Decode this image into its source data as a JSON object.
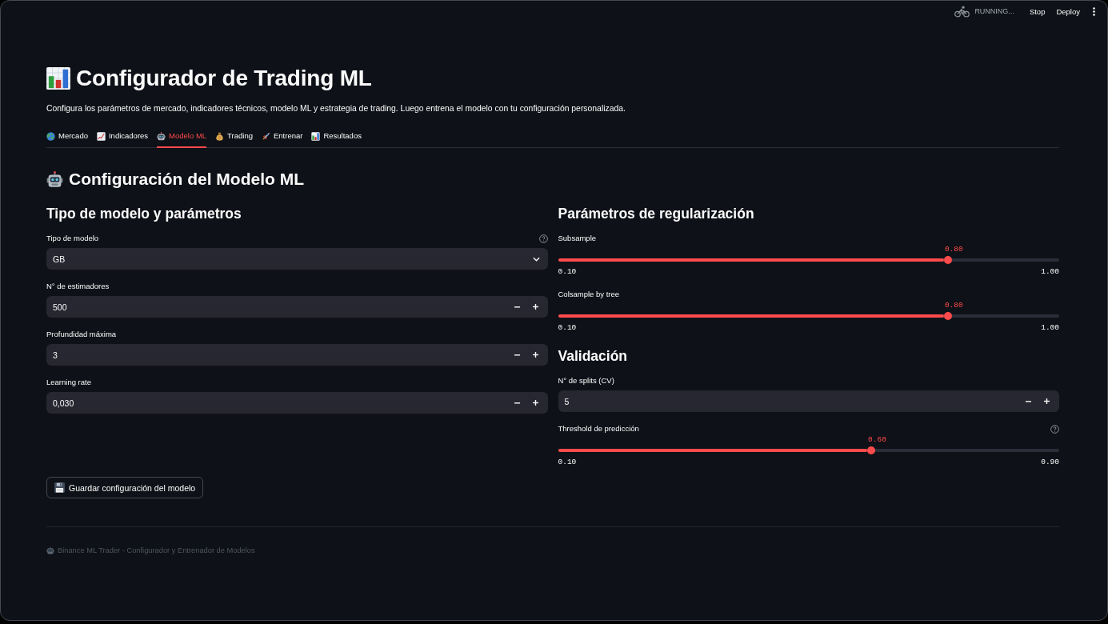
{
  "header": {
    "status": "RUNNING...",
    "buttons": [
      "Stop",
      "Deploy"
    ]
  },
  "page": {
    "title": "Configurador de Trading ML",
    "description": "Configura los parámetros de mercado, indicadores técnicos, modelo ML y estrategia de trading. Luego entrena el modelo con tu configuración personalizada."
  },
  "tabs": [
    {
      "label": "Mercado",
      "selected": false
    },
    {
      "label": "Indicadores",
      "selected": false
    },
    {
      "label": "Modelo ML",
      "selected": true
    },
    {
      "label": "Trading",
      "selected": false
    },
    {
      "label": "Entrenar",
      "selected": false
    },
    {
      "label": "Resultados",
      "selected": false
    }
  ],
  "section_title": "Configuración del Modelo ML",
  "columns": [
    {
      "sections": [
        {
          "heading": "Tipo de modelo y parámetros",
          "fields": [
            {
              "kind": "select",
              "label": "Tipo de modelo",
              "value": "GB",
              "help": true
            },
            {
              "kind": "number",
              "label": "N° de estimadores",
              "value": "500",
              "help": false
            },
            {
              "kind": "number",
              "label": "Profundidad máxima",
              "value": "3",
              "help": false
            },
            {
              "kind": "number",
              "label": "Learning rate",
              "value": "0,030",
              "help": false
            }
          ]
        }
      ]
    },
    {
      "sections": [
        {
          "heading": "Parámetros de regularización",
          "fields": [
            {
              "kind": "slider",
              "label": "Subsample",
              "value": "0.80",
              "level": 0.778,
              "min": "0.10",
              "max": "1.00",
              "help": false
            },
            {
              "kind": "slider",
              "label": "Colsample by tree",
              "value": "0.80",
              "level": 0.778,
              "min": "0.10",
              "max": "1.00",
              "help": false
            }
          ]
        },
        {
          "heading": "Validación",
          "fields": [
            {
              "kind": "number",
              "label": "N° de splits (CV)",
              "value": "5",
              "help": false
            },
            {
              "kind": "slider",
              "label": "Threshold de predicción",
              "value": "0.60",
              "level": 0.625,
              "min": "0.10",
              "max": "0.90",
              "help": true
            }
          ]
        }
      ]
    }
  ],
  "save_button": "Guardar configuración del modelo",
  "footer": "Binance ML Trader - Configurador y Entrenador de Modelos"
}
